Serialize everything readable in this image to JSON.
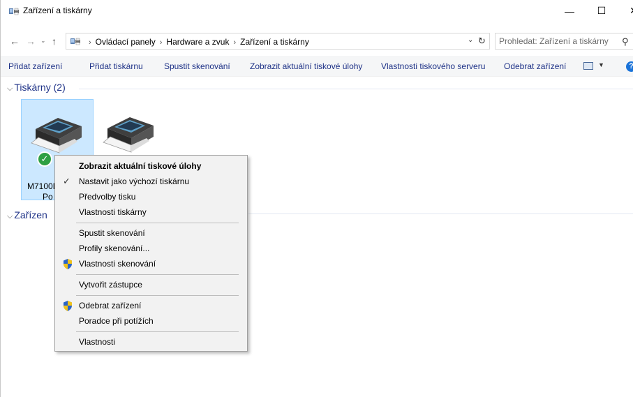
{
  "window": {
    "title": "Zařízení a tiskárny",
    "minimize_glyph": "—",
    "maximize_glyph": "☐",
    "close_glyph": "✕"
  },
  "address": {
    "back": "←",
    "forward": "→",
    "history": "⌄",
    "up": "↑",
    "crumbs": [
      "Ovládací panely",
      "Hardware a zvuk",
      "Zařízení a tiskárny"
    ],
    "separator": "›",
    "dropdown": "⌄",
    "refresh": "↻"
  },
  "search": {
    "placeholder": "Prohledat: Zařízení a tiskárny",
    "icon": "⚲"
  },
  "toolbar": {
    "add_device": "Přidat zařízení",
    "add_printer": "Přidat tiskárnu",
    "start_scan": "Spustit skenování",
    "see_print_jobs": "Zobrazit aktuální tiskové úlohy",
    "print_server_properties": "Vlastnosti tiskového serveru",
    "remove_device": "Odebrat zařízení",
    "view_drop": "▼",
    "help": "?"
  },
  "groups": {
    "printers": {
      "label": "Tiskárny",
      "count": "(2)"
    },
    "devices": {
      "label": "Zařízen"
    },
    "chevron": "⌵"
  },
  "devices": [
    {
      "label_line1": "M7100D",
      "label_line2": "Po",
      "is_default": true,
      "selected": true
    },
    {
      "label_line1": "",
      "label_line2": "",
      "is_default": false,
      "selected": false
    }
  ],
  "context_menu": {
    "items": [
      {
        "label": "Zobrazit aktuální tiskové úlohy",
        "bold": true
      },
      {
        "label": "Nastavit jako výchozí tiskárnu",
        "checked": true
      },
      {
        "label": "Předvolby tisku"
      },
      {
        "label": "Vlastnosti tiskárny"
      },
      {
        "label": "Spustit skenování"
      },
      {
        "label": "Profily skenování..."
      },
      {
        "label": "Vlastnosti skenování",
        "shield": true
      },
      {
        "label": "Vytvořit zástupce"
      },
      {
        "label": "Odebrat zařízení",
        "shield": true
      },
      {
        "label": "Poradce při potížích"
      },
      {
        "label": "Vlastnosti"
      }
    ],
    "check_glyph": "✓"
  },
  "colors": {
    "link_blue": "#1e3287",
    "selection": "#cce8ff",
    "default_check": "#2ea043"
  }
}
